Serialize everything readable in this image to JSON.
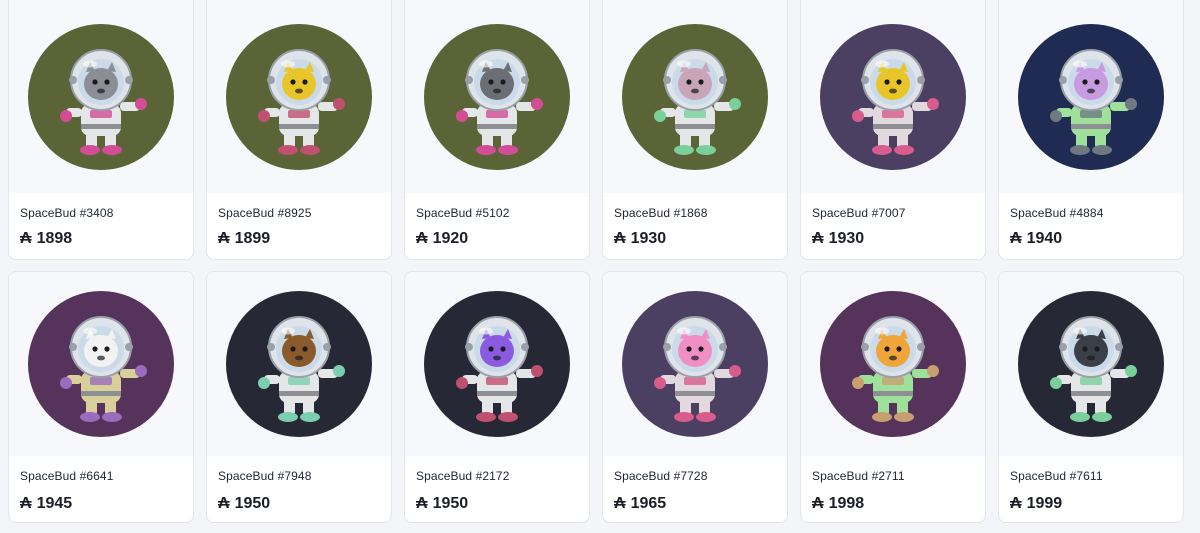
{
  "currency_symbol": "₳",
  "items": [
    {
      "name": "SpaceBud #3408",
      "price": "1898",
      "bg": "#5a6436",
      "face": "#8b8f95",
      "suit": "#e4e6e8",
      "accent": "#d24d96",
      "icon": "spacebud-bear-sunglasses-avatar"
    },
    {
      "name": "SpaceBud #8925",
      "price": "1899",
      "bg": "#5a6436",
      "face": "#e8c62a",
      "suit": "#e4e6e8",
      "accent": "#c05070",
      "icon": "spacebud-yellow-dragon-avatar"
    },
    {
      "name": "SpaceBud #5102",
      "price": "1920",
      "bg": "#5a6436",
      "face": "#6b6e74",
      "suit": "#e4e6e8",
      "accent": "#d24d96",
      "icon": "spacebud-grey-wolf-avatar"
    },
    {
      "name": "SpaceBud #1868",
      "price": "1930",
      "bg": "#5a6436",
      "face": "#c9a5b8",
      "suit": "#e4e6e8",
      "accent": "#7bcf9a",
      "icon": "spacebud-goggles-avatar"
    },
    {
      "name": "SpaceBud #7007",
      "price": "1930",
      "bg": "#4c4062",
      "face": "#e8c62a",
      "suit": "#e2d9df",
      "accent": "#d85d8c",
      "icon": "spacebud-yellow-dragon-pink-suit-avatar"
    },
    {
      "name": "SpaceBud #4884",
      "price": "1940",
      "bg": "#1f2b52",
      "face": "#c89be0",
      "suit": "#9fe09a",
      "accent": "#6e7a80",
      "icon": "spacebud-purple-monkey-avatar"
    },
    {
      "name": "SpaceBud #6641",
      "price": "1945",
      "bg": "#55335a",
      "face": "#f2f2f2",
      "suit": "#d8cf9a",
      "accent": "#9a6bbf",
      "icon": "spacebud-white-cat-camo-avatar"
    },
    {
      "name": "SpaceBud #7948",
      "price": "1950",
      "bg": "#262935",
      "face": "#8a5a2c",
      "suit": "#e4e6e8",
      "accent": "#7bcfb0",
      "icon": "spacebud-rottweiler-avatar"
    },
    {
      "name": "SpaceBud #2172",
      "price": "1950",
      "bg": "#262935",
      "face": "#8a5ae0",
      "suit": "#e4e6e8",
      "accent": "#c05070",
      "icon": "spacebud-purple-dragon-avatar"
    },
    {
      "name": "SpaceBud #7728",
      "price": "1965",
      "bg": "#4c4062",
      "face": "#ef8fc4",
      "suit": "#e2d9df",
      "accent": "#d85d8c",
      "icon": "spacebud-pink-cat-avatar"
    },
    {
      "name": "SpaceBud #2711",
      "price": "1998",
      "bg": "#55335a",
      "face": "#f0a53a",
      "suit": "#9fe09a",
      "accent": "#c8a070",
      "icon": "spacebud-orange-cat-green-suit-avatar"
    },
    {
      "name": "SpaceBud #7611",
      "price": "1999",
      "bg": "#262935",
      "face": "#3b3f48",
      "suit": "#e4e6e8",
      "accent": "#7bcf9a",
      "icon": "spacebud-robot-visor-avatar"
    }
  ]
}
